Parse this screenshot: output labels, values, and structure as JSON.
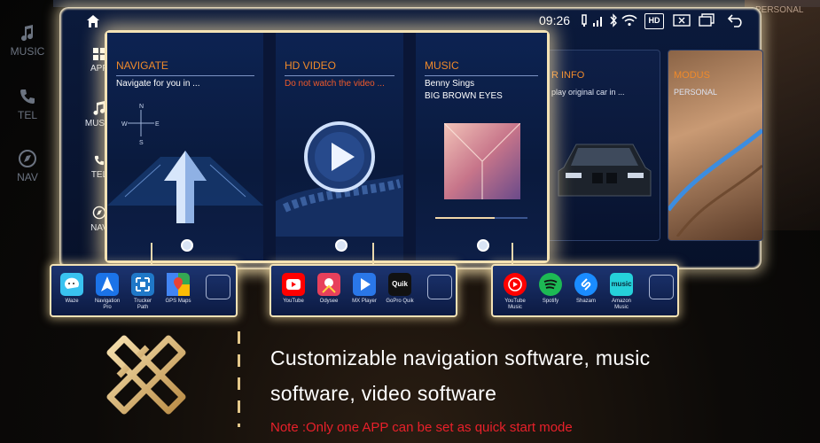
{
  "background": {
    "rail": [
      {
        "label": "MUSIC",
        "icon": "music-note-icon"
      },
      {
        "label": "TEL",
        "icon": "phone-icon"
      },
      {
        "label": "NAV",
        "icon": "compass-icon"
      }
    ],
    "right_card_label": "PERSONAL"
  },
  "status_bar": {
    "time": "09:26",
    "hd_label": "HD",
    "icons": [
      "usb-icon",
      "signal-icon",
      "bluetooth-icon",
      "wifi-icon",
      "hd-icon",
      "screen-close-icon",
      "window-icon",
      "back-icon"
    ]
  },
  "sidebar": {
    "items": [
      {
        "label": "APP",
        "icon": "apps-grid-icon"
      },
      {
        "label": "MUSIC",
        "icon": "music-note-icon"
      },
      {
        "label": "TEL",
        "icon": "phone-icon"
      },
      {
        "label": "NAV",
        "icon": "compass-icon"
      }
    ]
  },
  "cards": [
    {
      "title": "NAVIGATE",
      "subtitle": "Navigate for you in ..."
    },
    {
      "title": "HD VIDEO",
      "subtitle": "Do not watch the video ..."
    },
    {
      "title": "MUSIC",
      "artist": "Benny Sings",
      "track": "BIG BROWN EYES"
    }
  ],
  "back_cards": [
    {
      "title": "R INFO",
      "subtitle": "play original car in ..."
    },
    {
      "title": "MODUS",
      "subtitle": "PERSONAL"
    }
  ],
  "docks": [
    {
      "apps": [
        {
          "name": "Waze",
          "color": "#39c2f0"
        },
        {
          "name": "Navigation Pro",
          "color": "#1b73e8"
        },
        {
          "name": "Trucker Path",
          "color": "#1f78c8"
        },
        {
          "name": "GPS Maps",
          "color": "#34a853"
        }
      ]
    },
    {
      "apps": [
        {
          "name": "YouTube",
          "color": "#ff0000"
        },
        {
          "name": "Odysee",
          "color": "#e7405b"
        },
        {
          "name": "MX Player",
          "color": "#2a77e8"
        },
        {
          "name": "GoPro Quik",
          "color": "#111111",
          "tile_text": "Quik"
        }
      ]
    },
    {
      "apps": [
        {
          "name": "YouTube Music",
          "color": "#ff0000"
        },
        {
          "name": "Spotify",
          "color": "#1db954"
        },
        {
          "name": "Shazam",
          "color": "#1a8cff"
        },
        {
          "name": "Amazon Music",
          "color": "#25d1da",
          "tile_text": "music"
        }
      ]
    }
  ],
  "caption": {
    "line1": "Customizable navigation software, music",
    "line2": "software, video software",
    "note": "Note :Only one APP can be set as quick start mode"
  },
  "colors": {
    "accent_orange": "#f08a2a",
    "glow": "#f3e2b5",
    "note_red": "#e8202a"
  }
}
